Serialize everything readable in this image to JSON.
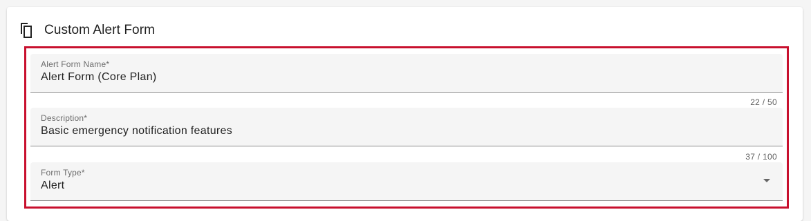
{
  "card": {
    "title": "Custom Alert Form",
    "icon": "copy-icon"
  },
  "form": {
    "name_field": {
      "label": "Alert Form Name*",
      "value": "Alert Form (Core Plan)",
      "counter": "22 / 50"
    },
    "description_field": {
      "label": "Description*",
      "value": "Basic emergency notification features",
      "counter": "37 / 100"
    },
    "form_type_field": {
      "label": "Form Type*",
      "selected": "Alert",
      "icon": "arrow-drop-down-icon"
    }
  },
  "colors": {
    "highlight_border": "#c8102e",
    "field_background": "#f5f5f5",
    "text_primary": "#212121",
    "text_secondary": "#6b6b6b"
  }
}
